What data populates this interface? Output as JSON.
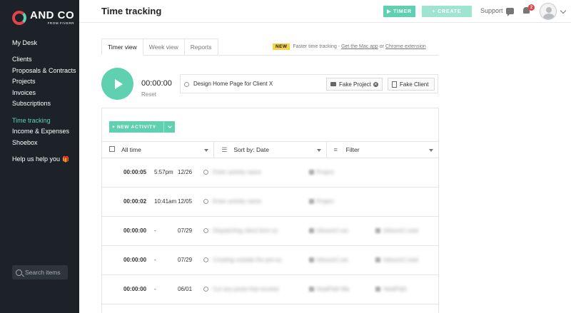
{
  "brand": {
    "name": "AND CO",
    "sub": "FROM FIVERR"
  },
  "sidebar": {
    "items": [
      {
        "label": "My Desk",
        "active": false
      },
      {
        "label": "Clients",
        "active": false
      },
      {
        "label": "Proposals & Contracts",
        "active": false
      },
      {
        "label": "Projects",
        "active": false
      },
      {
        "label": "Invoices",
        "active": false
      },
      {
        "label": "Subscriptions",
        "active": false
      },
      {
        "label": "Time tracking",
        "active": true
      },
      {
        "label": "Income & Expenses",
        "active": false
      },
      {
        "label": "Shoebox",
        "active": false
      },
      {
        "label": "Help us help you",
        "active": false
      }
    ],
    "search_placeholder": "Search items"
  },
  "header": {
    "title": "Time tracking",
    "timer_label": "▶ TIMER",
    "create_label": "+ CREATE",
    "support_label": "Support",
    "notification_count": "2"
  },
  "tabs": [
    {
      "label": "Timer view",
      "active": true
    },
    {
      "label": "Week view",
      "active": false
    },
    {
      "label": "Reports",
      "active": false
    }
  ],
  "promo": {
    "badge": "NEW",
    "text": "Faster time tracking -",
    "mac_link": "Get the Mac app",
    "or": "or",
    "chrome_link": "Chrome extension"
  },
  "timer": {
    "value": "00:00:00",
    "reset_label": "Reset",
    "description": "Design Home Page for Client X",
    "project": "Fake Project",
    "client": "Fake Client"
  },
  "activity": {
    "new_label": "+ NEW ACTIVITY",
    "filters": {
      "range": "All time",
      "sort": "Sort by: Date",
      "filter": "Filter"
    },
    "rows": [
      {
        "duration": "00:00:05",
        "time": "5:57pm",
        "date": "12/26",
        "desc": "Enter activity name",
        "project": "Project",
        "client": ""
      },
      {
        "duration": "00:00:02",
        "time": "10:41am",
        "date": "12/05",
        "desc": "Enter activity name",
        "project": "Project",
        "client": ""
      },
      {
        "duration": "00:00:00",
        "time": "-",
        "date": "07/29",
        "desc": "Dispatching client form so",
        "project": "Inbound Lea",
        "client": "Inbound Lead"
      },
      {
        "duration": "00:00:00",
        "time": "-",
        "date": "07/29",
        "desc": "Creating outside the pre-so",
        "project": "Inbound Lea",
        "client": "Inbound Lead"
      },
      {
        "duration": "00:00:00",
        "time": "-",
        "date": "06/01",
        "desc": "Cut any posts that exceed",
        "project": "HealPath Ma",
        "client": "HealPath"
      }
    ]
  }
}
